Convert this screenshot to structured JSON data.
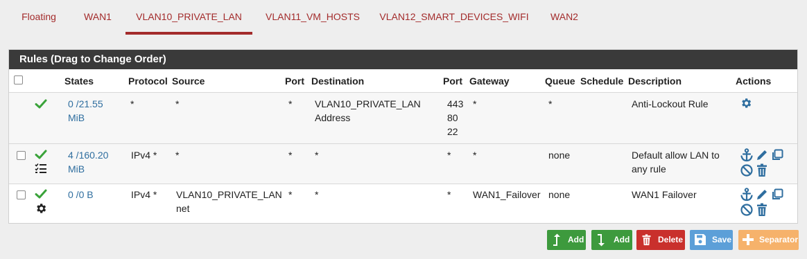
{
  "tabs": [
    "Floating",
    "WAN1",
    "VLAN10_PRIVATE_LAN",
    "VLAN11_VM_HOSTS",
    "VLAN12_SMART_DEVICES_WIFI",
    "WAN2"
  ],
  "active_tab": "VLAN10_PRIVATE_LAN",
  "panel": {
    "title": "Rules (Drag to Change Order)",
    "headers": {
      "states": "States",
      "protocol": "Protocol",
      "source": "Source",
      "port": "Port",
      "destination": "Destination",
      "port2": "Port",
      "gateway": "Gateway",
      "queue": "Queue",
      "schedule": "Schedule",
      "description": "Description",
      "actions": "Actions"
    }
  },
  "rules": [
    {
      "states_line1": "0 /21.55",
      "states_line2": "MiB",
      "protocol": "*",
      "source": "*",
      "port": "*",
      "destination_line1": "VLAN10_PRIVATE_LAN",
      "destination_line2": "Address",
      "dport_line1": "443",
      "dport_line2": "80",
      "dport_line3": "22",
      "gateway": "*",
      "queue": "*",
      "schedule": "",
      "description": "Anti-Lockout Rule"
    },
    {
      "states_line1": "4 /160.20",
      "states_line2": "MiB",
      "protocol": "IPv4 *",
      "source": "*",
      "port": "*",
      "destination": "*",
      "dport": "*",
      "gateway": "*",
      "queue": "none",
      "schedule": "",
      "description_line1": "Default allow LAN to",
      "description_line2": "any rule"
    },
    {
      "states": "0 /0 B",
      "protocol": "IPv4 *",
      "source_line1": "VLAN10_PRIVATE_LAN",
      "source_line2": "net",
      "port": "*",
      "destination": "*",
      "dport": "*",
      "gateway": "WAN1_Failover",
      "queue": "none",
      "schedule": "",
      "description": "WAN1 Failover"
    }
  ],
  "buttons": {
    "add_top": "Add",
    "add_bottom": "Add",
    "delete": "Delete",
    "save": "Save",
    "separator": "Separator"
  },
  "colors": {
    "accent": "#a32b2b",
    "link": "#2f6e9f",
    "pass": "#3aa33a",
    "btn_add": "#3d9a3d",
    "btn_delete": "#c9302c",
    "btn_save": "#5c9fd8",
    "btn_separator": "#f6b26b"
  }
}
